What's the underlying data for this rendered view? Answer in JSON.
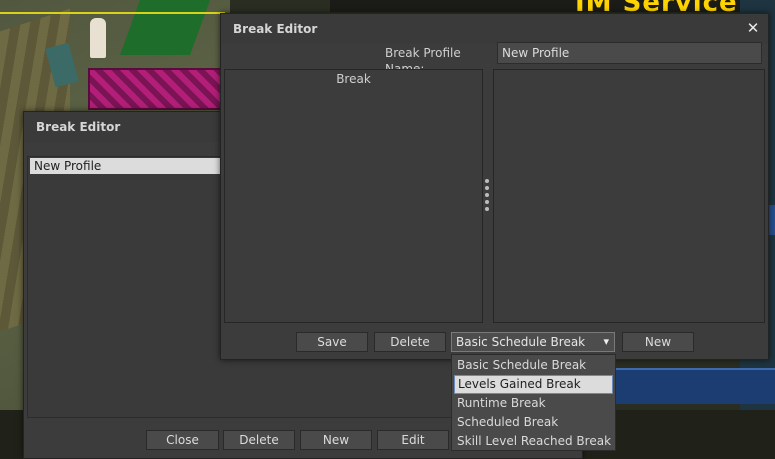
{
  "background": {
    "service_banner_text": "IM Service"
  },
  "back_window": {
    "title": "Break Editor",
    "profiles": [
      "New Profile"
    ],
    "buttons": {
      "close": "Close",
      "delete": "Delete",
      "new": "New",
      "edit": "Edit"
    }
  },
  "front_window": {
    "title": "Break Editor",
    "close_glyph": "✕",
    "profile_name_label": "Break Profile Name:",
    "profile_name_value": "New Profile",
    "left_panel_header": "Break",
    "buttons": {
      "save": "Save",
      "delete": "Delete",
      "new": "New"
    },
    "break_type_select": {
      "selected": "Basic Schedule Break",
      "caret": "▾"
    }
  },
  "dropdown": {
    "options": [
      "Basic Schedule Break",
      "Levels Gained Break",
      "Runtime Break",
      "Scheduled Break",
      "Skill Level Reached Break"
    ],
    "highlighted_index": 1
  },
  "colors": {
    "window_bg": "#3c3c3c",
    "button_bg": "#4a4a4a",
    "highlight": "#dcdcdc",
    "service_yellow": "#ffd400"
  }
}
